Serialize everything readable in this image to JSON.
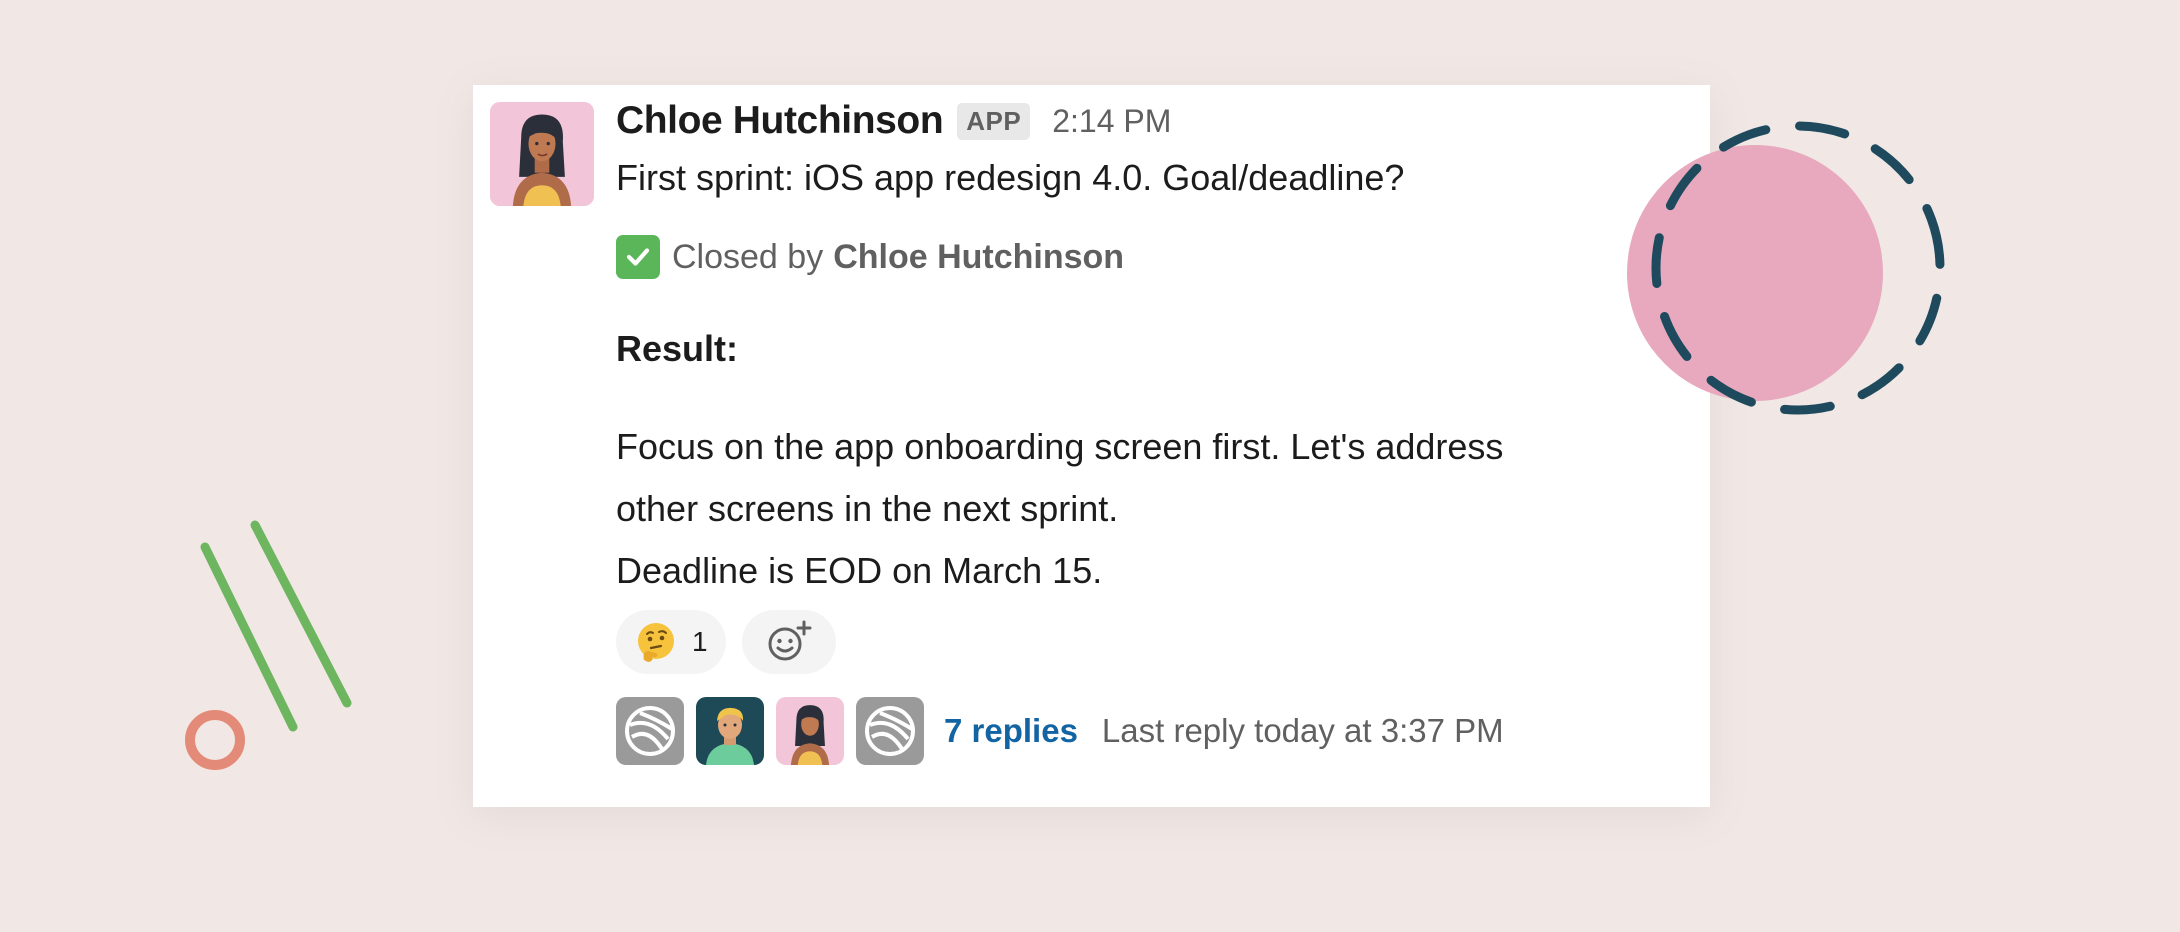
{
  "message": {
    "author": "Chloe Hutchinson",
    "badge": "APP",
    "time": "2:14 PM",
    "text": "First sprint: iOS app redesign 4.0. Goal/deadline?"
  },
  "status": {
    "icon": "check-mark-icon",
    "label": "Closed by",
    "closed_by": "Chloe Hutchinson"
  },
  "result": {
    "title": "Result:",
    "lines": [
      "Focus on the app onboarding screen first. Let's address",
      "other screens in the next sprint.",
      "Deadline is EOD on March 15."
    ]
  },
  "reactions": [
    {
      "emoji": "thinking-face",
      "count": "1"
    }
  ],
  "thread": {
    "participants": [
      "generic-avatar",
      "man-avatar",
      "chloe-avatar",
      "generic-avatar"
    ],
    "replies": "7 replies",
    "last_reply": "Last reply today at 3:37 PM"
  },
  "colors": {
    "background": "#f1e8e6",
    "link": "#1264a3",
    "check": "#5bb65a",
    "deco_pink": "#e8a9be",
    "deco_navy": "#1f4a5e",
    "deco_green": "#6db55f",
    "deco_coral": "#e38b78"
  }
}
